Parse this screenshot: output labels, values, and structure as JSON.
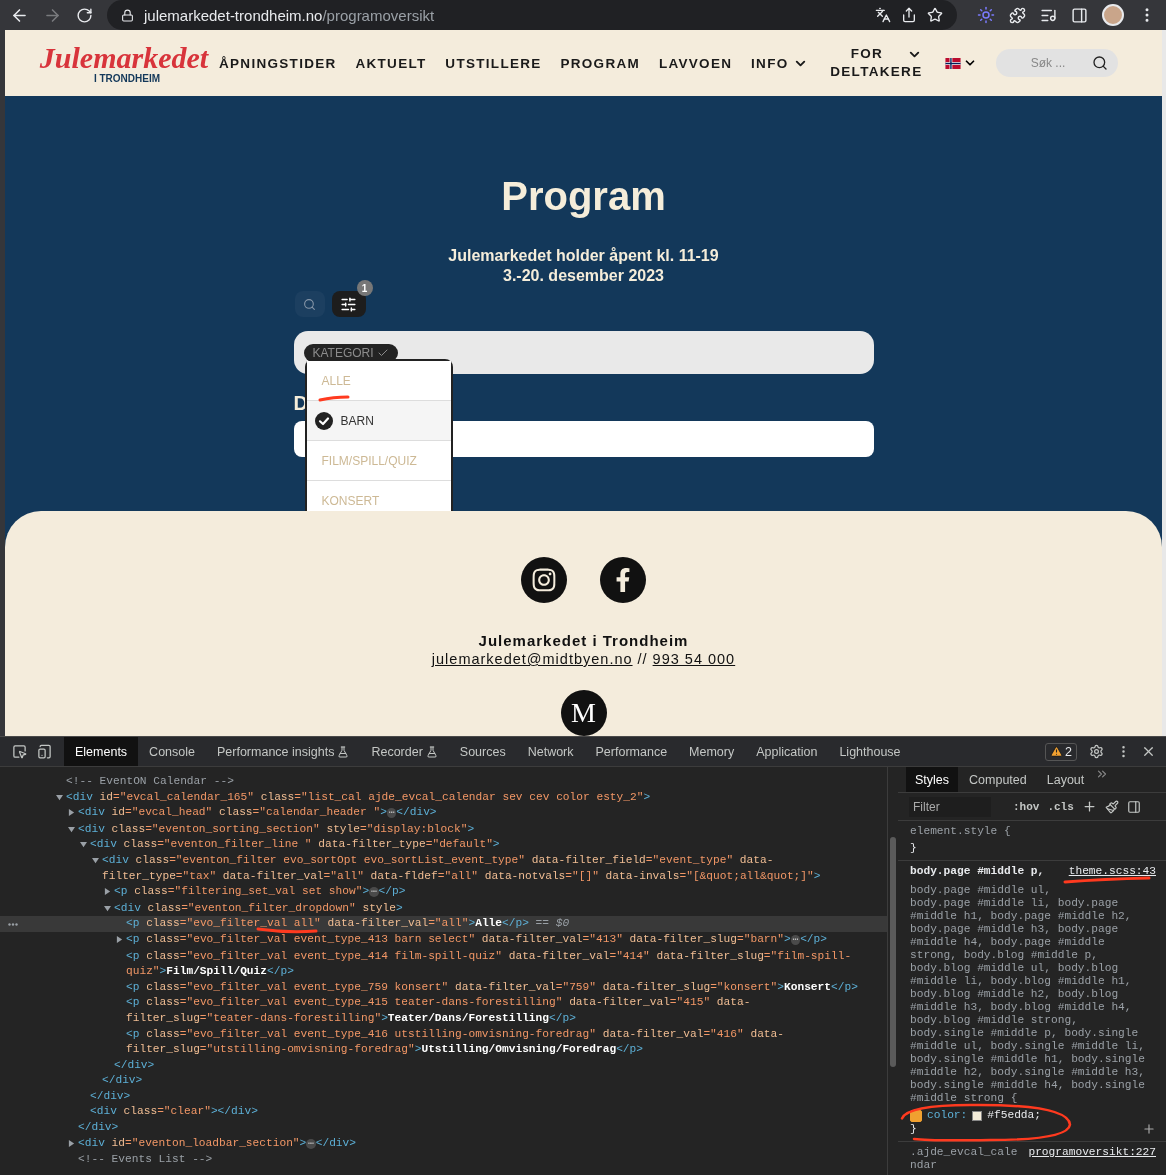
{
  "browser": {
    "host": "julemarkedet-trondheim.no",
    "path": "/programoversikt",
    "back_enabled": true,
    "forward_enabled": false
  },
  "header": {
    "logo": {
      "script": "Julemarkedet",
      "sub": "I TRONDHEIM"
    },
    "nav": [
      {
        "label": "ÅPNINGSTIDER",
        "dropdown": false
      },
      {
        "label": "AKTUELT",
        "dropdown": false
      },
      {
        "label": "UTSTILLERE",
        "dropdown": false
      },
      {
        "label": "PROGRAM",
        "dropdown": false
      },
      {
        "label": "LAVVOEN",
        "dropdown": false
      },
      {
        "label": "INFO",
        "dropdown": true
      },
      {
        "label": "FOR DELTAKERE",
        "dropdown": true
      }
    ],
    "search": {
      "placeholder": "Søk ..."
    }
  },
  "hero": {
    "title": "Program",
    "lines": [
      "Julemarkedet holder åpent kl. 11-19",
      "3.-20. desember 2023"
    ],
    "filter_count": "1",
    "chip": "KATEGORI",
    "heading_fragment": "D",
    "dropdown": [
      {
        "label": "ALLE",
        "selected": false
      },
      {
        "label": "BARN",
        "selected": true
      },
      {
        "label": "FILM/SPILL/QUIZ",
        "selected": false
      },
      {
        "label": "KONSERT",
        "selected": false
      }
    ]
  },
  "footer": {
    "name": "Julemarkedet i Trondheim",
    "email": "julemarkedet@midtbyen.no",
    "separator": "//",
    "phone": "993 54 000",
    "badge": "M"
  },
  "devtools": {
    "tabs": [
      {
        "label": "Elements",
        "selected": true,
        "experimental": false
      },
      {
        "label": "Console",
        "selected": false,
        "experimental": false
      },
      {
        "label": "Performance insights",
        "selected": false,
        "experimental": true
      },
      {
        "label": "Recorder",
        "selected": false,
        "experimental": true
      },
      {
        "label": "Sources",
        "selected": false,
        "experimental": false
      },
      {
        "label": "Network",
        "selected": false,
        "experimental": false
      },
      {
        "label": "Performance",
        "selected": false,
        "experimental": false
      },
      {
        "label": "Memory",
        "selected": false,
        "experimental": false
      },
      {
        "label": "Application",
        "selected": false,
        "experimental": false
      },
      {
        "label": "Lighthouse",
        "selected": false,
        "experimental": false
      }
    ],
    "warnings": "2",
    "tree": [
      {
        "selected": false,
        "line": [
          {
            "kind": "comment",
            "text": "<!-- EventON Calendar -->"
          }
        ]
      },
      {
        "selected": false,
        "expanded": true,
        "line": [
          {
            "kind": "tag",
            "text": "<div"
          },
          {
            "kind": "attr",
            "text": " id"
          },
          {
            "kind": "value",
            "text": "=\"evcal_calendar_165\""
          },
          {
            "kind": "attr",
            "text": " class"
          },
          {
            "kind": "value",
            "text": "=\"list_cal ajde_evcal_calendar sev cev color esty_2\""
          },
          {
            "kind": "tag",
            "text": ">"
          }
        ],
        "children": [
          {
            "selected": false,
            "expanded": false,
            "line": [
              {
                "kind": "tag",
                "text": "<div"
              },
              {
                "kind": "attr",
                "text": " id"
              },
              {
                "kind": "value",
                "text": "=\"evcal_head\""
              },
              {
                "kind": "attr",
                "text": " class"
              },
              {
                "kind": "value",
                "text": "=\"calendar_header \""
              },
              {
                "kind": "tag",
                "text": ">"
              },
              {
                "kind": "ellipsis",
                "text": "⋯"
              },
              {
                "kind": "tag",
                "text": "</div>"
              }
            ]
          },
          {
            "selected": false,
            "expanded": true,
            "line": [
              {
                "kind": "tag",
                "text": "<div"
              },
              {
                "kind": "attr",
                "text": " class"
              },
              {
                "kind": "value",
                "text": "=\"eventon_sorting_section\""
              },
              {
                "kind": "attr",
                "text": " style"
              },
              {
                "kind": "value",
                "text": "=\"display:block\""
              },
              {
                "kind": "tag",
                "text": ">"
              }
            ],
            "children": [
              {
                "selected": false,
                "expanded": true,
                "line": [
                  {
                    "kind": "tag",
                    "text": "<div"
                  },
                  {
                    "kind": "attr",
                    "text": " class"
                  },
                  {
                    "kind": "value",
                    "text": "=\"eventon_filter_line \""
                  },
                  {
                    "kind": "attr",
                    "text": " data-filter_type"
                  },
                  {
                    "kind": "value",
                    "text": "=\"default\""
                  },
                  {
                    "kind": "tag",
                    "text": ">"
                  }
                ],
                "children": [
                  {
                    "selected": false,
                    "expanded": true,
                    "line": [
                      {
                        "kind": "tag",
                        "text": "<div"
                      },
                      {
                        "kind": "attr",
                        "text": " class"
                      },
                      {
                        "kind": "value",
                        "text": "=\"eventon_filter evo_sortOpt evo_sortList_event_type\""
                      },
                      {
                        "kind": "attr",
                        "text": " data-filter_field"
                      },
                      {
                        "kind": "value",
                        "text": "=\"event_type\""
                      },
                      {
                        "kind": "attr",
                        "text": " data-filter_type"
                      },
                      {
                        "kind": "value",
                        "text": "=\"tax\""
                      },
                      {
                        "kind": "attr",
                        "text": " data-filter_val"
                      },
                      {
                        "kind": "value",
                        "text": "=\"all\""
                      },
                      {
                        "kind": "attr",
                        "text": " data-fldef"
                      },
                      {
                        "kind": "value",
                        "text": "=\"all\""
                      },
                      {
                        "kind": "attr",
                        "text": " data-notvals"
                      },
                      {
                        "kind": "value",
                        "text": "=\"[]\""
                      },
                      {
                        "kind": "attr",
                        "text": " data-invals"
                      },
                      {
                        "kind": "value",
                        "text": "=\"[&quot;all&quot;]\""
                      },
                      {
                        "kind": "tag",
                        "text": ">"
                      }
                    ],
                    "children": [
                      {
                        "selected": false,
                        "expanded": false,
                        "line": [
                          {
                            "kind": "tag",
                            "text": "<p"
                          },
                          {
                            "kind": "attr",
                            "text": " class"
                          },
                          {
                            "kind": "value",
                            "text": "=\"filtering_set_val set show\""
                          },
                          {
                            "kind": "tag",
                            "text": ">"
                          },
                          {
                            "kind": "ellipsis",
                            "text": "⋯"
                          },
                          {
                            "kind": "tag",
                            "text": "</p>"
                          }
                        ]
                      },
                      {
                        "selected": false,
                        "expanded": true,
                        "line": [
                          {
                            "kind": "tag",
                            "text": "<div"
                          },
                          {
                            "kind": "attr",
                            "text": " class"
                          },
                          {
                            "kind": "value",
                            "text": "=\"eventon_filter_dropdown\""
                          },
                          {
                            "kind": "attr",
                            "text": " style"
                          },
                          {
                            "kind": "tag",
                            "text": ">"
                          }
                        ],
                        "children": [
                          {
                            "selected": true,
                            "line": [
                              {
                                "kind": "tag",
                                "text": "<p"
                              },
                              {
                                "kind": "attr",
                                "text": " class"
                              },
                              {
                                "kind": "value",
                                "text": "=\"evo_filter_val all\""
                              },
                              {
                                "kind": "attr",
                                "text": " data-filter_val"
                              },
                              {
                                "kind": "value",
                                "text": "=\"all\""
                              },
                              {
                                "kind": "tag",
                                "text": ">"
                              },
                              {
                                "kind": "text",
                                "text": "Alle"
                              },
                              {
                                "kind": "tag",
                                "text": "</p>"
                              },
                              {
                                "kind": "marker",
                                "text": " == $0"
                              }
                            ]
                          },
                          {
                            "selected": false,
                            "expanded": false,
                            "line": [
                              {
                                "kind": "tag",
                                "text": "<p"
                              },
                              {
                                "kind": "attr",
                                "text": " class"
                              },
                              {
                                "kind": "value",
                                "text": "=\"evo_filter_val event_type_413 barn select\""
                              },
                              {
                                "kind": "attr",
                                "text": " data-filter_val"
                              },
                              {
                                "kind": "value",
                                "text": "=\"413\""
                              },
                              {
                                "kind": "attr",
                                "text": " data-filter_slug"
                              },
                              {
                                "kind": "value",
                                "text": "=\"barn\""
                              },
                              {
                                "kind": "tag",
                                "text": ">"
                              },
                              {
                                "kind": "ellipsis",
                                "text": "⋯"
                              },
                              {
                                "kind": "tag",
                                "text": "</p>"
                              }
                            ]
                          },
                          {
                            "selected": false,
                            "line": [
                              {
                                "kind": "tag",
                                "text": "<p"
                              },
                              {
                                "kind": "attr",
                                "text": " class"
                              },
                              {
                                "kind": "value",
                                "text": "=\"evo_filter_val event_type_414 film-spill-quiz\""
                              },
                              {
                                "kind": "attr",
                                "text": " data-filter_val"
                              },
                              {
                                "kind": "value",
                                "text": "=\"414\""
                              },
                              {
                                "kind": "attr",
                                "text": " data-filter_slug"
                              },
                              {
                                "kind": "value",
                                "text": "=\"film-spill-quiz\""
                              },
                              {
                                "kind": "tag",
                                "text": ">"
                              },
                              {
                                "kind": "text",
                                "text": "Film/Spill/Quiz"
                              },
                              {
                                "kind": "tag",
                                "text": "</p>"
                              }
                            ]
                          },
                          {
                            "selected": false,
                            "line": [
                              {
                                "kind": "tag",
                                "text": "<p"
                              },
                              {
                                "kind": "attr",
                                "text": " class"
                              },
                              {
                                "kind": "value",
                                "text": "=\"evo_filter_val event_type_759 konsert\""
                              },
                              {
                                "kind": "attr",
                                "text": " data-filter_val"
                              },
                              {
                                "kind": "value",
                                "text": "=\"759\""
                              },
                              {
                                "kind": "attr",
                                "text": " data-filter_slug"
                              },
                              {
                                "kind": "value",
                                "text": "=\"konsert\""
                              },
                              {
                                "kind": "tag",
                                "text": ">"
                              },
                              {
                                "kind": "text",
                                "text": "Konsert"
                              },
                              {
                                "kind": "tag",
                                "text": "</p>"
                              }
                            ]
                          },
                          {
                            "selected": false,
                            "line": [
                              {
                                "kind": "tag",
                                "text": "<p"
                              },
                              {
                                "kind": "attr",
                                "text": " class"
                              },
                              {
                                "kind": "value",
                                "text": "=\"evo_filter_val event_type_415 teater-dans-forestilling\""
                              },
                              {
                                "kind": "attr",
                                "text": " data-filter_val"
                              },
                              {
                                "kind": "value",
                                "text": "=\"415\""
                              },
                              {
                                "kind": "attr",
                                "text": " data-filter_slug"
                              },
                              {
                                "kind": "value",
                                "text": "=\"teater-dans-forestilling\""
                              },
                              {
                                "kind": "tag",
                                "text": ">"
                              },
                              {
                                "kind": "text",
                                "text": "Teater/Dans/Forestilling"
                              },
                              {
                                "kind": "tag",
                                "text": "</p>"
                              }
                            ]
                          },
                          {
                            "selected": false,
                            "line": [
                              {
                                "kind": "tag",
                                "text": "<p"
                              },
                              {
                                "kind": "attr",
                                "text": " class"
                              },
                              {
                                "kind": "value",
                                "text": "=\"evo_filter_val event_type_416 utstilling-omvisning-foredrag\""
                              },
                              {
                                "kind": "attr",
                                "text": " data-filter_val"
                              },
                              {
                                "kind": "value",
                                "text": "=\"416\""
                              },
                              {
                                "kind": "attr",
                                "text": " data-filter_slug"
                              },
                              {
                                "kind": "value",
                                "text": "=\"utstilling-omvisning-foredrag\""
                              },
                              {
                                "kind": "tag",
                                "text": ">"
                              },
                              {
                                "kind": "text",
                                "text": "Utstilling/Omvisning/Foredrag"
                              },
                              {
                                "kind": "tag",
                                "text": "</p>"
                              }
                            ]
                          }
                        ],
                        "close": [
                          {
                            "kind": "tag",
                            "text": "</div>"
                          }
                        ]
                      }
                    ],
                    "close": [
                      {
                        "kind": "tag",
                        "text": "</div>"
                      }
                    ]
                  }
                ],
                "close": [
                  {
                    "kind": "tag",
                    "text": "</div>"
                  }
                ]
              },
              {
                "selected": false,
                "line": [
                  {
                    "kind": "tag",
                    "text": "<div"
                  },
                  {
                    "kind": "attr",
                    "text": " class"
                  },
                  {
                    "kind": "value",
                    "text": "=\"clear\""
                  },
                  {
                    "kind": "tag",
                    "text": "></div>"
                  }
                ]
              }
            ],
            "close": [
              {
                "kind": "tag",
                "text": "</div>"
              }
            ]
          },
          {
            "selected": false,
            "expanded": false,
            "line": [
              {
                "kind": "tag",
                "text": "<div"
              },
              {
                "kind": "attr",
                "text": " id"
              },
              {
                "kind": "value",
                "text": "=\"eventon_loadbar_section\""
              },
              {
                "kind": "tag",
                "text": ">"
              },
              {
                "kind": "ellipsis",
                "text": "⋯"
              },
              {
                "kind": "tag",
                "text": "</div>"
              }
            ]
          },
          {
            "selected": false,
            "line": [
              {
                "kind": "comment",
                "text": "<!-- Events List -->"
              }
            ]
          }
        ]
      }
    ],
    "styles": {
      "tabs": [
        {
          "label": "Styles",
          "selected": true
        },
        {
          "label": "Computed",
          "selected": false
        },
        {
          "label": "Layout",
          "selected": false
        }
      ],
      "filter": {
        "placeholder": "Filter"
      },
      "toggles": [
        ":hov",
        ".cls"
      ],
      "rules": [
        {
          "selectors": [
            {
              "text": "element.style {",
              "matched": false
            }
          ],
          "close": "}"
        },
        {
          "selectors": [
            {
              "text": "body.page #middle p,",
              "matched": true
            },
            {
              "text": "body.page #middle ul, body.page #middle li, body.page #middle h1, body.page #middle h2, body.page #middle h3, body.page #middle h4, body.page #middle strong, body.blog #middle p, body.blog #middle ul, body.blog #middle li, body.blog #middle h1, body.blog #middle h2, body.blog #middle h3, body.blog #middle h4, body.blog #middle strong, body.single #middle p, body.single #middle ul, body.single #middle li, body.single #middle h1, body.single #middle h2, body.single #middle h3, body.single #middle h4, body.single #middle strong {",
              "matched": false
            }
          ],
          "source": "theme.scss:43",
          "properties": [
            {
              "name": "color:",
              "value": "#f5edda;",
              "checked": true
            }
          ],
          "close": "}"
        },
        {
          "selectors": [
            {
              "text": ".ajde_evcal_calendar",
              "matched": false
            }
          ],
          "source": "programoversikt:227"
        }
      ]
    }
  }
}
